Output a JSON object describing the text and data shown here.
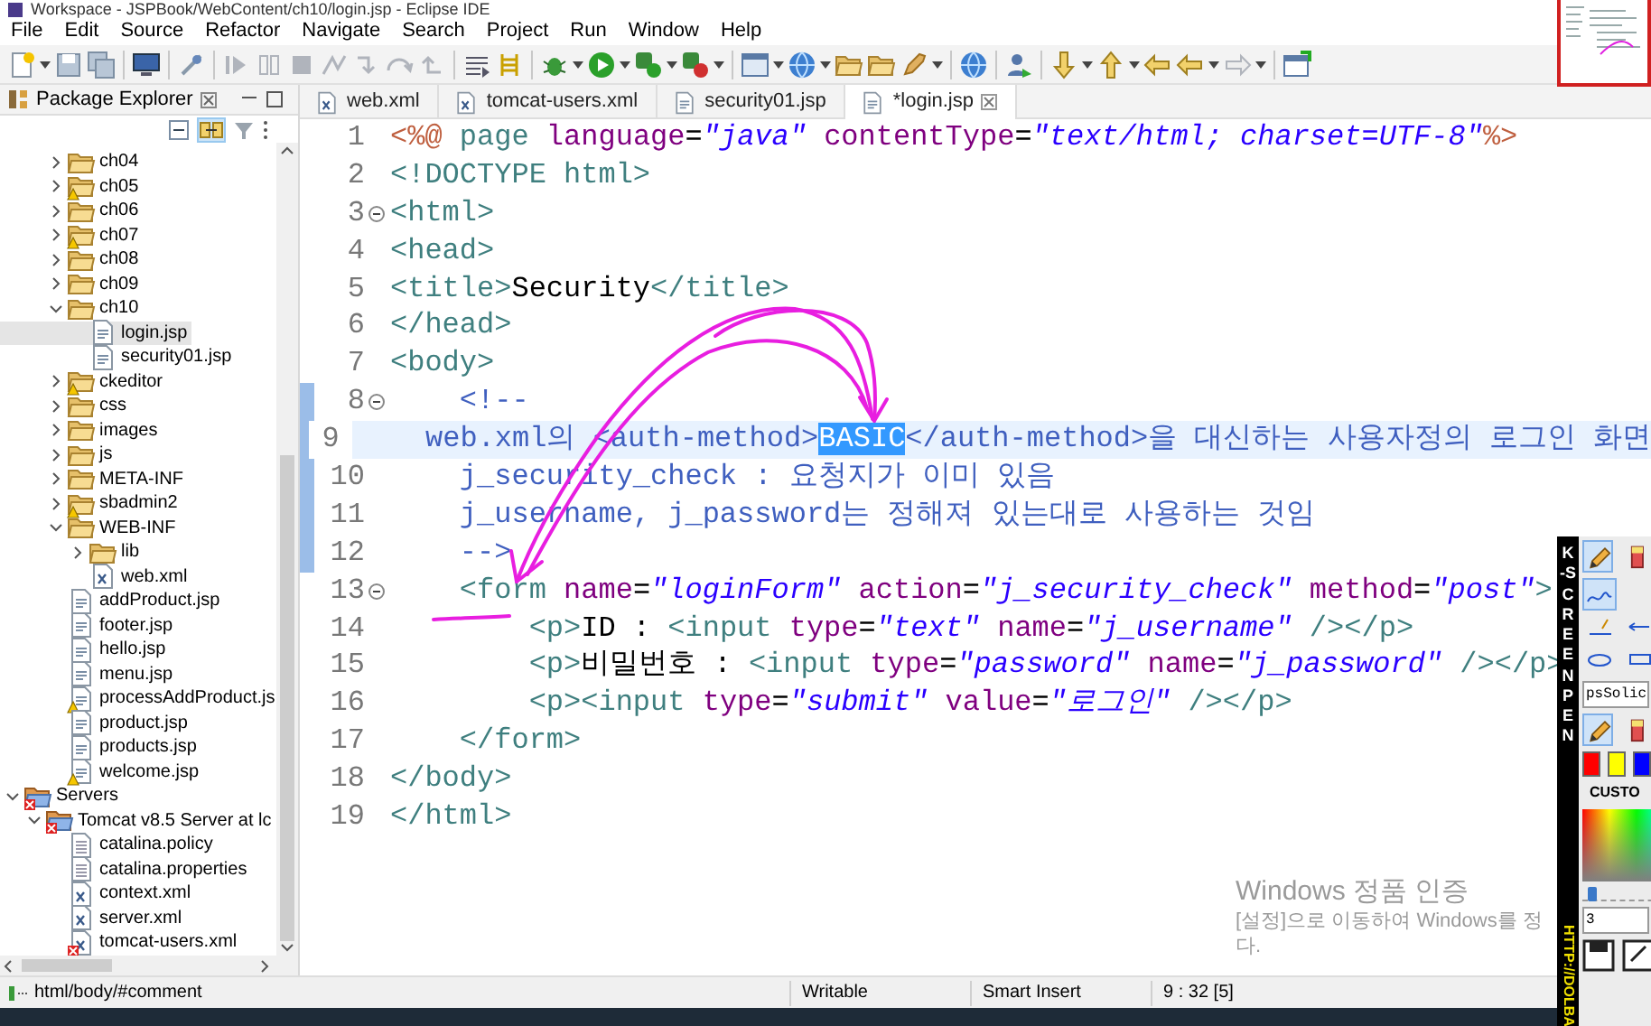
{
  "window": {
    "title": "Workspace - JSPBook/WebContent/ch10/login.jsp - Eclipse IDE"
  },
  "menu": [
    "File",
    "Edit",
    "Source",
    "Refactor",
    "Navigate",
    "Search",
    "Project",
    "Run",
    "Window",
    "Help"
  ],
  "package_explorer": {
    "title": "Package Explorer",
    "link_with_editor": true,
    "tree": {
      "partial_branch": [
        {
          "label": "ch04",
          "kind": "folder",
          "expanded": false,
          "selected": false
        },
        {
          "label": "ch05",
          "kind": "folder",
          "expanded": false,
          "selected": false,
          "warning": true
        },
        {
          "label": "ch06",
          "kind": "folder",
          "expanded": false,
          "selected": false
        },
        {
          "label": "ch07",
          "kind": "folder",
          "expanded": false,
          "selected": false,
          "warning": true
        },
        {
          "label": "ch08",
          "kind": "folder",
          "expanded": false,
          "selected": false
        },
        {
          "label": "ch09",
          "kind": "folder",
          "expanded": false,
          "selected": false
        },
        {
          "label": "ch10",
          "kind": "folder",
          "expanded": true,
          "selected": false,
          "children": [
            {
              "label": "login.jsp",
              "kind": "jsp",
              "selected": true
            },
            {
              "label": "security01.jsp",
              "kind": "jsp",
              "selected": false
            }
          ]
        },
        {
          "label": "ckeditor",
          "kind": "folder",
          "expanded": false,
          "selected": false,
          "warning": true
        },
        {
          "label": "css",
          "kind": "folder",
          "expanded": false,
          "selected": false
        },
        {
          "label": "images",
          "kind": "folder",
          "expanded": false,
          "selected": false
        },
        {
          "label": "js",
          "kind": "folder",
          "expanded": false,
          "selected": false
        },
        {
          "label": "META-INF",
          "kind": "folder",
          "expanded": false,
          "selected": false
        },
        {
          "label": "sbadmin2",
          "kind": "folder",
          "expanded": false,
          "selected": false,
          "warning": true
        },
        {
          "label": "WEB-INF",
          "kind": "folder",
          "expanded": true,
          "selected": false,
          "children": [
            {
              "label": "lib",
              "kind": "folder",
              "expanded": false,
              "selected": false
            },
            {
              "label": "web.xml",
              "kind": "xml",
              "selected": false
            }
          ]
        },
        {
          "label": "addProduct.jsp",
          "kind": "jsp",
          "selected": false
        },
        {
          "label": "footer.jsp",
          "kind": "jsp",
          "selected": false
        },
        {
          "label": "hello.jsp",
          "kind": "jsp",
          "selected": false
        },
        {
          "label": "menu.jsp",
          "kind": "jsp",
          "selected": false
        },
        {
          "label": "processAddProduct.js",
          "kind": "jsp",
          "selected": false,
          "warning": true
        },
        {
          "label": "product.jsp",
          "kind": "jsp",
          "selected": false
        },
        {
          "label": "products.jsp",
          "kind": "jsp",
          "selected": false
        },
        {
          "label": "welcome.jsp",
          "kind": "jsp",
          "selected": false,
          "warning": true
        }
      ],
      "projects": [
        {
          "label": "Servers",
          "kind": "server",
          "expanded": true,
          "selected": false,
          "error": true,
          "children": [
            {
              "label": "Tomcat v8.5 Server at lc",
              "kind": "server",
              "expanded": true,
              "selected": false,
              "error": true,
              "children": [
                {
                  "label": "catalina.policy",
                  "kind": "text",
                  "selected": false
                },
                {
                  "label": "catalina.properties",
                  "kind": "text",
                  "selected": false
                },
                {
                  "label": "context.xml",
                  "kind": "xml",
                  "selected": false
                },
                {
                  "label": "server.xml",
                  "kind": "xml",
                  "selected": false
                },
                {
                  "label": "tomcat-users.xml",
                  "kind": "xml",
                  "selected": false,
                  "error": true
                }
              ]
            }
          ]
        }
      ]
    }
  },
  "editor": {
    "tabs": [
      {
        "label": "web.xml",
        "kind": "xml",
        "selected": false
      },
      {
        "label": "tomcat-users.xml",
        "kind": "xml",
        "selected": false
      },
      {
        "label": "security01.jsp",
        "kind": "jsp",
        "selected": false
      },
      {
        "label": "*login.jsp",
        "kind": "jsp",
        "selected": true
      }
    ],
    "lines": [
      {
        "number": "1",
        "segments": [
          {
            "kind": "directive",
            "text": "<%@"
          },
          {
            "kind": "tag",
            "text": " page"
          },
          {
            "kind": "attr",
            "text": " language"
          },
          {
            "kind": "plain",
            "text": "="
          },
          {
            "kind": "string",
            "text": "\"java\""
          },
          {
            "kind": "attr",
            "text": " contentType"
          },
          {
            "kind": "plain",
            "text": "="
          },
          {
            "kind": "string",
            "text": "\"text/html; charset=UTF-8\""
          },
          {
            "kind": "directive",
            "text": "%>"
          }
        ]
      },
      {
        "number": "2",
        "segments": [
          {
            "kind": "tag",
            "text": "<!DOCTYPE html>"
          }
        ]
      },
      {
        "number": "3",
        "fold": true,
        "segments": [
          {
            "kind": "tag",
            "text": "<html>"
          }
        ]
      },
      {
        "number": "4",
        "segments": [
          {
            "kind": "tag",
            "text": "<head>"
          }
        ]
      },
      {
        "number": "5",
        "segments": [
          {
            "kind": "tag",
            "text": "<title>"
          },
          {
            "kind": "plain",
            "text": "Security"
          },
          {
            "kind": "tag",
            "text": "</title>"
          }
        ]
      },
      {
        "number": "6",
        "segments": [
          {
            "kind": "tag",
            "text": "</head>"
          }
        ]
      },
      {
        "number": "7",
        "segments": [
          {
            "kind": "tag",
            "text": "<body>"
          }
        ]
      },
      {
        "number": "8",
        "fold": true,
        "fold_range": true,
        "segments": [
          {
            "kind": "comment",
            "text": "\t<!--"
          }
        ]
      },
      {
        "number": "9",
        "fold_range": true,
        "current": true,
        "segments": [
          {
            "kind": "comment",
            "text": "\tweb.xml의 <auth-method>"
          },
          {
            "kind": "comment",
            "text": "BASIC",
            "selected": true
          },
          {
            "kind": "comment",
            "text": "</auth-method>을 대신하는 사용자정의 로그인 화면"
          }
        ]
      },
      {
        "number": "10",
        "fold_range": true,
        "segments": [
          {
            "kind": "comment",
            "text": "\tj_security_check : 요청지가 이미 있음"
          }
        ]
      },
      {
        "number": "11",
        "fold_range": true,
        "segments": [
          {
            "kind": "comment",
            "text": "\tj_username, j_password는 정해져 있는대로 사용하는 것임"
          }
        ]
      },
      {
        "number": "12",
        "fold_range": true,
        "segments": [
          {
            "kind": "comment",
            "text": "\t-->"
          }
        ]
      },
      {
        "number": "13",
        "fold": true,
        "segments": [
          {
            "kind": "tag",
            "text": "\t<form"
          },
          {
            "kind": "attr",
            "text": " name"
          },
          {
            "kind": "plain",
            "text": "="
          },
          {
            "kind": "string",
            "text": "\"loginForm\""
          },
          {
            "kind": "attr",
            "text": " action"
          },
          {
            "kind": "plain",
            "text": "="
          },
          {
            "kind": "string",
            "text": "\"j_security_check\""
          },
          {
            "kind": "attr",
            "text": " method"
          },
          {
            "kind": "plain",
            "text": "="
          },
          {
            "kind": "string",
            "text": "\"post\""
          },
          {
            "kind": "tag",
            "text": ">"
          }
        ]
      },
      {
        "number": "14",
        "segments": [
          {
            "kind": "tag",
            "text": "\t\t<p>"
          },
          {
            "kind": "plain",
            "text": "ID : "
          },
          {
            "kind": "tag",
            "text": "<input"
          },
          {
            "kind": "attr",
            "text": " type"
          },
          {
            "kind": "plain",
            "text": "="
          },
          {
            "kind": "string",
            "text": "\"text\""
          },
          {
            "kind": "attr",
            "text": " name"
          },
          {
            "kind": "plain",
            "text": "="
          },
          {
            "kind": "string",
            "text": "\"j_username\""
          },
          {
            "kind": "tag",
            "text": " /></p>"
          }
        ]
      },
      {
        "number": "15",
        "segments": [
          {
            "kind": "tag",
            "text": "\t\t<p>"
          },
          {
            "kind": "plain",
            "text": "비밀번호 : "
          },
          {
            "kind": "tag",
            "text": "<input"
          },
          {
            "kind": "attr",
            "text": " type"
          },
          {
            "kind": "plain",
            "text": "="
          },
          {
            "kind": "string",
            "text": "\"password\""
          },
          {
            "kind": "attr",
            "text": " name"
          },
          {
            "kind": "plain",
            "text": "="
          },
          {
            "kind": "string",
            "text": "\"j_password\""
          },
          {
            "kind": "tag",
            "text": " /></p>"
          }
        ]
      },
      {
        "number": "16",
        "segments": [
          {
            "kind": "tag",
            "text": "\t\t<p><input"
          },
          {
            "kind": "attr",
            "text": " type"
          },
          {
            "kind": "plain",
            "text": "="
          },
          {
            "kind": "string",
            "text": "\"submit\""
          },
          {
            "kind": "attr",
            "text": " value"
          },
          {
            "kind": "plain",
            "text": "="
          },
          {
            "kind": "string",
            "text": "\"로그인\""
          },
          {
            "kind": "tag",
            "text": " /></p>"
          }
        ]
      },
      {
        "number": "17",
        "segments": [
          {
            "kind": "tag",
            "text": "\t</form>"
          }
        ]
      },
      {
        "number": "18",
        "segments": [
          {
            "kind": "tag",
            "text": "</body>"
          }
        ]
      },
      {
        "number": "19",
        "segments": [
          {
            "kind": "tag",
            "text": "</html>"
          }
        ]
      }
    ]
  },
  "status_bar": {
    "path": "html/body/#comment",
    "cells": [
      "Writable",
      "Smart Insert",
      "9 : 32 [5]"
    ]
  },
  "os_notice": {
    "title": "Windows 정품 인증",
    "lines": [
      "[설정]으로 이동하여 Windows를 정",
      "다."
    ]
  },
  "pen_panel": {
    "title": "K-SCREEN PEN",
    "url": "HTTP://DOLBA",
    "tools": [
      {
        "kind": "pencil",
        "selected": true
      },
      {
        "kind": "marker",
        "selected": false
      }
    ],
    "styles": [
      {
        "kind": "freehand",
        "selected": true
      },
      {
        "kind": "line",
        "selected": false
      },
      {
        "kind": "arrow",
        "selected": false
      },
      {
        "kind": "ellipse",
        "selected": false
      },
      {
        "kind": "box",
        "selected": false
      }
    ],
    "style_field": "psSolic",
    "brushes": [
      {
        "kind": "pencil",
        "selected": true
      },
      {
        "kind": "marker",
        "selected": false
      }
    ],
    "swatches": [
      {
        "color": "#ff0000"
      },
      {
        "color": "#ffff00"
      },
      {
        "color": "#0000ff"
      }
    ],
    "palette_label": "CUSTO",
    "pen_width": {
      "level": 0.05
    },
    "width_field": "3"
  }
}
